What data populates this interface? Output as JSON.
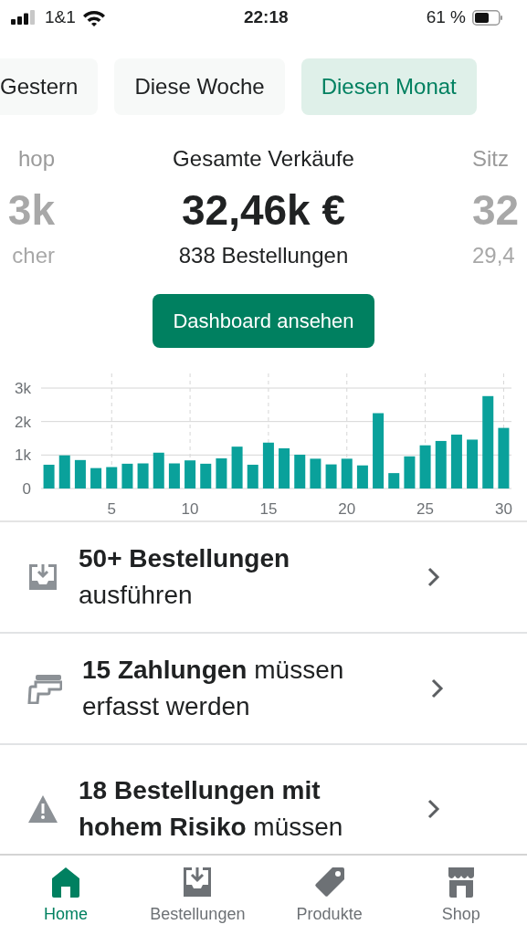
{
  "status_bar": {
    "carrier": "1&1",
    "time": "22:18",
    "battery": "61 %"
  },
  "period_tabs": [
    {
      "label": "Gestern",
      "selected": false
    },
    {
      "label": "Diese Woche",
      "selected": false
    },
    {
      "label": "Diesen Monat",
      "selected": true
    }
  ],
  "stats": [
    {
      "title": "hop",
      "value": "3k",
      "sub": "cher",
      "selected": false
    },
    {
      "title": "Gesamte Verkäufe",
      "value": "32,46k €",
      "sub": "838 Bestellungen",
      "selected": true
    },
    {
      "title": "Sitz",
      "value": "32",
      "sub": "29,4",
      "selected": false
    }
  ],
  "dashboard_button": "Dashboard ansehen",
  "chart": {
    "chart_data": {
      "type": "bar",
      "x": [
        1,
        2,
        3,
        4,
        5,
        6,
        7,
        8,
        9,
        10,
        11,
        12,
        13,
        14,
        15,
        16,
        17,
        18,
        19,
        20,
        21,
        22,
        23,
        24,
        25,
        26,
        27,
        28,
        29,
        30
      ],
      "grid": true,
      "xlim": [
        0.5,
        30.5
      ],
      "series": [
        {
          "color": "#0aa19b",
          "values": [
            710,
            990,
            850,
            610,
            640,
            740,
            750,
            1070,
            750,
            840,
            740,
            900,
            1250,
            710,
            1370,
            1200,
            1010,
            890,
            720,
            890,
            690,
            2250,
            460,
            960,
            1290,
            1420,
            1610,
            1460,
            2760,
            1810
          ]
        }
      ],
      "ylim": [
        0,
        3000
      ],
      "yticks": [
        {
          "value": 0,
          "label": "0"
        },
        {
          "value": 1000,
          "label": "1k"
        },
        {
          "value": 2000,
          "label": "2k"
        },
        {
          "value": 3000,
          "label": "3k"
        }
      ],
      "xticks": [
        5,
        10,
        15,
        20,
        25,
        30
      ]
    }
  },
  "tasks": [
    {
      "kind": "orders",
      "text": "**50+ Bestellungen** ausführen"
    },
    {
      "kind": "payments",
      "text": "**15 Zahlungen** müssen erfasst werden"
    },
    {
      "kind": "risk",
      "text": "**18 Bestellungen mit hohem Risiko** müssen"
    }
  ],
  "tab_bar": [
    {
      "kind": "home",
      "label": "Home",
      "selected": true
    },
    {
      "kind": "orders",
      "label": "Bestellungen",
      "selected": false
    },
    {
      "kind": "products",
      "label": "Produkte",
      "selected": false
    },
    {
      "kind": "shop",
      "label": "Shop",
      "selected": false
    }
  ]
}
